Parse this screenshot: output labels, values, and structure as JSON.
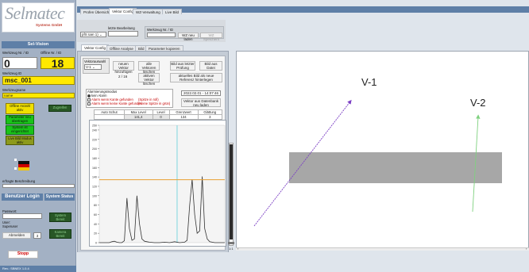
{
  "logo": {
    "brand": "Selmatec",
    "sub": "Systems GmbH"
  },
  "left": {
    "section_title": "Sel-Vision",
    "tool_no_label": "Werkzeug Nr. / ID",
    "tool_no_value": "0",
    "offline_label": "Offline Nr. / ID",
    "offline_value": "18",
    "tool_id_label": "Werkzeug ID",
    "tool_id_value": "msc_001",
    "tool_name_label": "Werkzeugname",
    "tool_name_value": "name",
    "offline_count_label": "Offline Anzahl aktiv",
    "parameter_label": "Parameter neu übertragen",
    "system_label": "System ist eingerichtet",
    "live_bild_label": "Live Bild Modus aktiv",
    "status_right_label": "Zugreifen",
    "tool_desc_label": "erfragte Beschreibung",
    "login_title": "Benutzer Login",
    "system_status_title": "System Status",
    "password_label": "Passwort:",
    "user_label": "User:",
    "user_value": "Superuser",
    "logout_label": "Abmelden",
    "level_value": "3",
    "status_box1": "System Bereit",
    "status_box2": "Kamera Bereit",
    "stop_label": "Stopp",
    "version_text": "Rev.: SBNEX 1.0.4"
  },
  "top_tabs": [
    "Profen Übersicht",
    "Vektor Config",
    "WZ-Verwaltung",
    "Live Bild"
  ],
  "active_top_tab": 1,
  "toolbar": {
    "select_value": "pfS üan 1)",
    "last_edit_label": "letzte Bearbeitung",
    "tool_label": "Werkzeug Nr. / ID",
    "load_label": "WZ neu laden",
    "save_label": "WZ Speichern"
  },
  "sub_tabs": [
    "Vektor Config",
    "Offline Analyse",
    "Bild",
    "Parameter kopieren"
  ],
  "active_sub_tab": 0,
  "vector": {
    "select_label": "Vektorauswahl",
    "select_value": "V-1",
    "new_btn": "neuen Vektor hinzufügen",
    "delete_all_btn": "alle Vektoren löschen",
    "check_btn": "Bild aus letzter Prüfung",
    "file_btn": "Bild aus Datei",
    "count_value": "2 / 16",
    "delete_active_btn": "aktiven Vektor löschen",
    "ref_btn": "aktuelles Bild als neue Referenz hinterlegen"
  },
  "alarm": {
    "title": "Alarmierungsmodus",
    "opt1": "kein Alarm",
    "opt2": "Alarm wenn Kante gefunden",
    "opt2_note": "(Spitze in roll)",
    "opt3": "Alarm wenn keine Kante gefunden",
    "opt3_note": "(Keine Spitze in grün)",
    "timestamp": "2022.02.01 - 14:07:46",
    "db_btn": "Vektor aus Datenbank neu laden"
  },
  "measure": {
    "headers": [
      "Auto Schut",
      "Max Level",
      "Level",
      "Grenzwert",
      "Glättung"
    ],
    "values": [
      "",
      "141,4",
      "0",
      "134",
      "3"
    ]
  },
  "chart_data": {
    "type": "line",
    "title": "",
    "ylim": [
      0,
      250
    ],
    "y_ticks": [
      "0",
      "20",
      "40",
      "60",
      "80",
      "100",
      "120",
      "140",
      "160",
      "180",
      "200",
      "220",
      "240",
      "250"
    ],
    "threshold": 134,
    "series": [
      {
        "x": [
          0,
          8,
          10,
          12,
          14,
          16,
          18,
          20,
          22,
          24,
          26,
          28,
          30,
          32,
          34,
          36,
          38,
          40,
          44,
          48,
          52,
          56,
          60,
          64,
          68,
          70,
          72,
          74,
          76,
          78,
          80,
          82,
          84,
          86,
          88,
          92,
          100
        ],
        "values": [
          0,
          0,
          2,
          3,
          1,
          0,
          0,
          4,
          95,
          30,
          5,
          8,
          100,
          40,
          8,
          3,
          2,
          1,
          0,
          0,
          1,
          0,
          2,
          0,
          1,
          5,
          80,
          135,
          60,
          20,
          25,
          141,
          30,
          8,
          2,
          0,
          0
        ]
      }
    ],
    "x_max": 100
  },
  "vectors": [
    {
      "label": "V-1",
      "color": "#7b3fc4"
    },
    {
      "label": "V-2",
      "color": "#7fd17f"
    }
  ],
  "view": {
    "zoom": "1:1"
  },
  "colors": {
    "header": "#5e7fa7",
    "threshold": "#e8a030",
    "cursor": "#7fd7e0"
  }
}
